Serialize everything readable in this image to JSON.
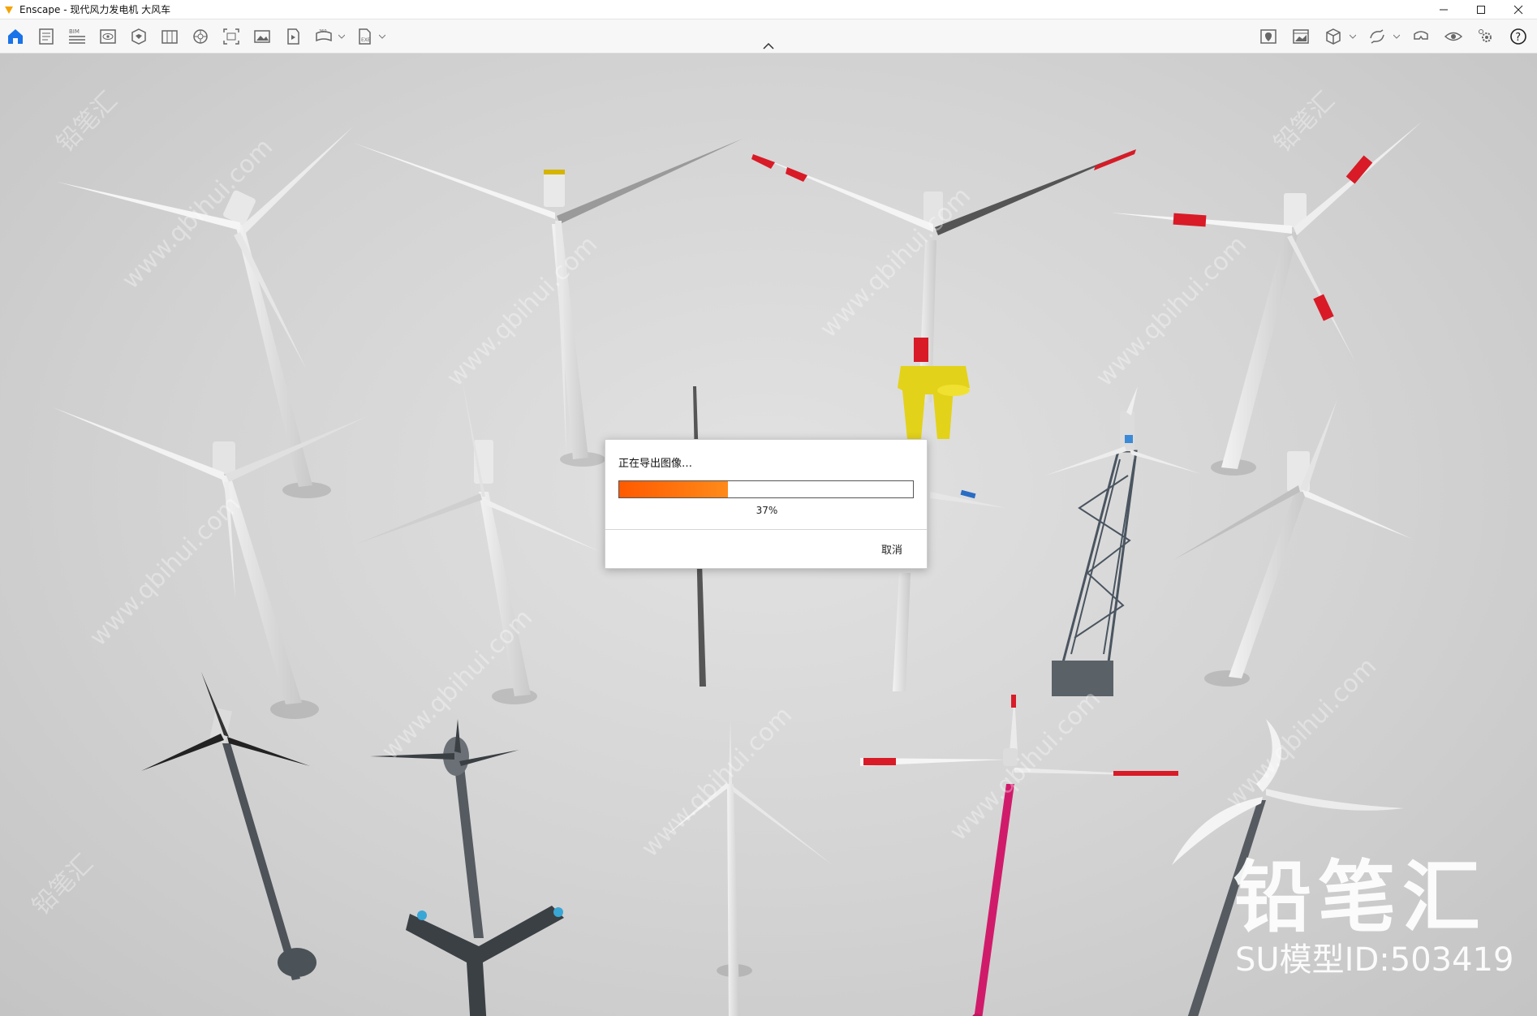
{
  "window": {
    "title": "Enscape - 现代风力发电机 大风车",
    "controls": [
      "minimize-icon",
      "maximize-icon",
      "close-icon"
    ]
  },
  "toolbar": {
    "left_icons": [
      "home-icon",
      "notes-icon",
      "bim-icon",
      "view-icon",
      "asset-library-icon",
      "materials-icon",
      "atmosphere-icon",
      "screenshot-icon",
      "image-icon",
      "video-icon",
      "panorama-icon",
      "export-icon"
    ],
    "bim_label": "BIM",
    "right_icons": [
      "map-icon",
      "gallery-icon",
      "cube-icon",
      "sync-icon",
      "vr-icon",
      "eye-icon",
      "settings-icon",
      "help-icon"
    ]
  },
  "dialog": {
    "title": "正在导出图像…",
    "progress": 0.37,
    "progress_text": "37%",
    "cancel_label": "取消"
  },
  "watermark": {
    "logo": "铅笔汇",
    "model_id": "SU模型ID:503419",
    "tile_a": "www.qbihui.com",
    "tile_b": "铅笔汇"
  },
  "colors": {
    "accent": "#1a73e8",
    "progress": "#ff6a00",
    "viewport_bg": "#d6d6d6"
  }
}
